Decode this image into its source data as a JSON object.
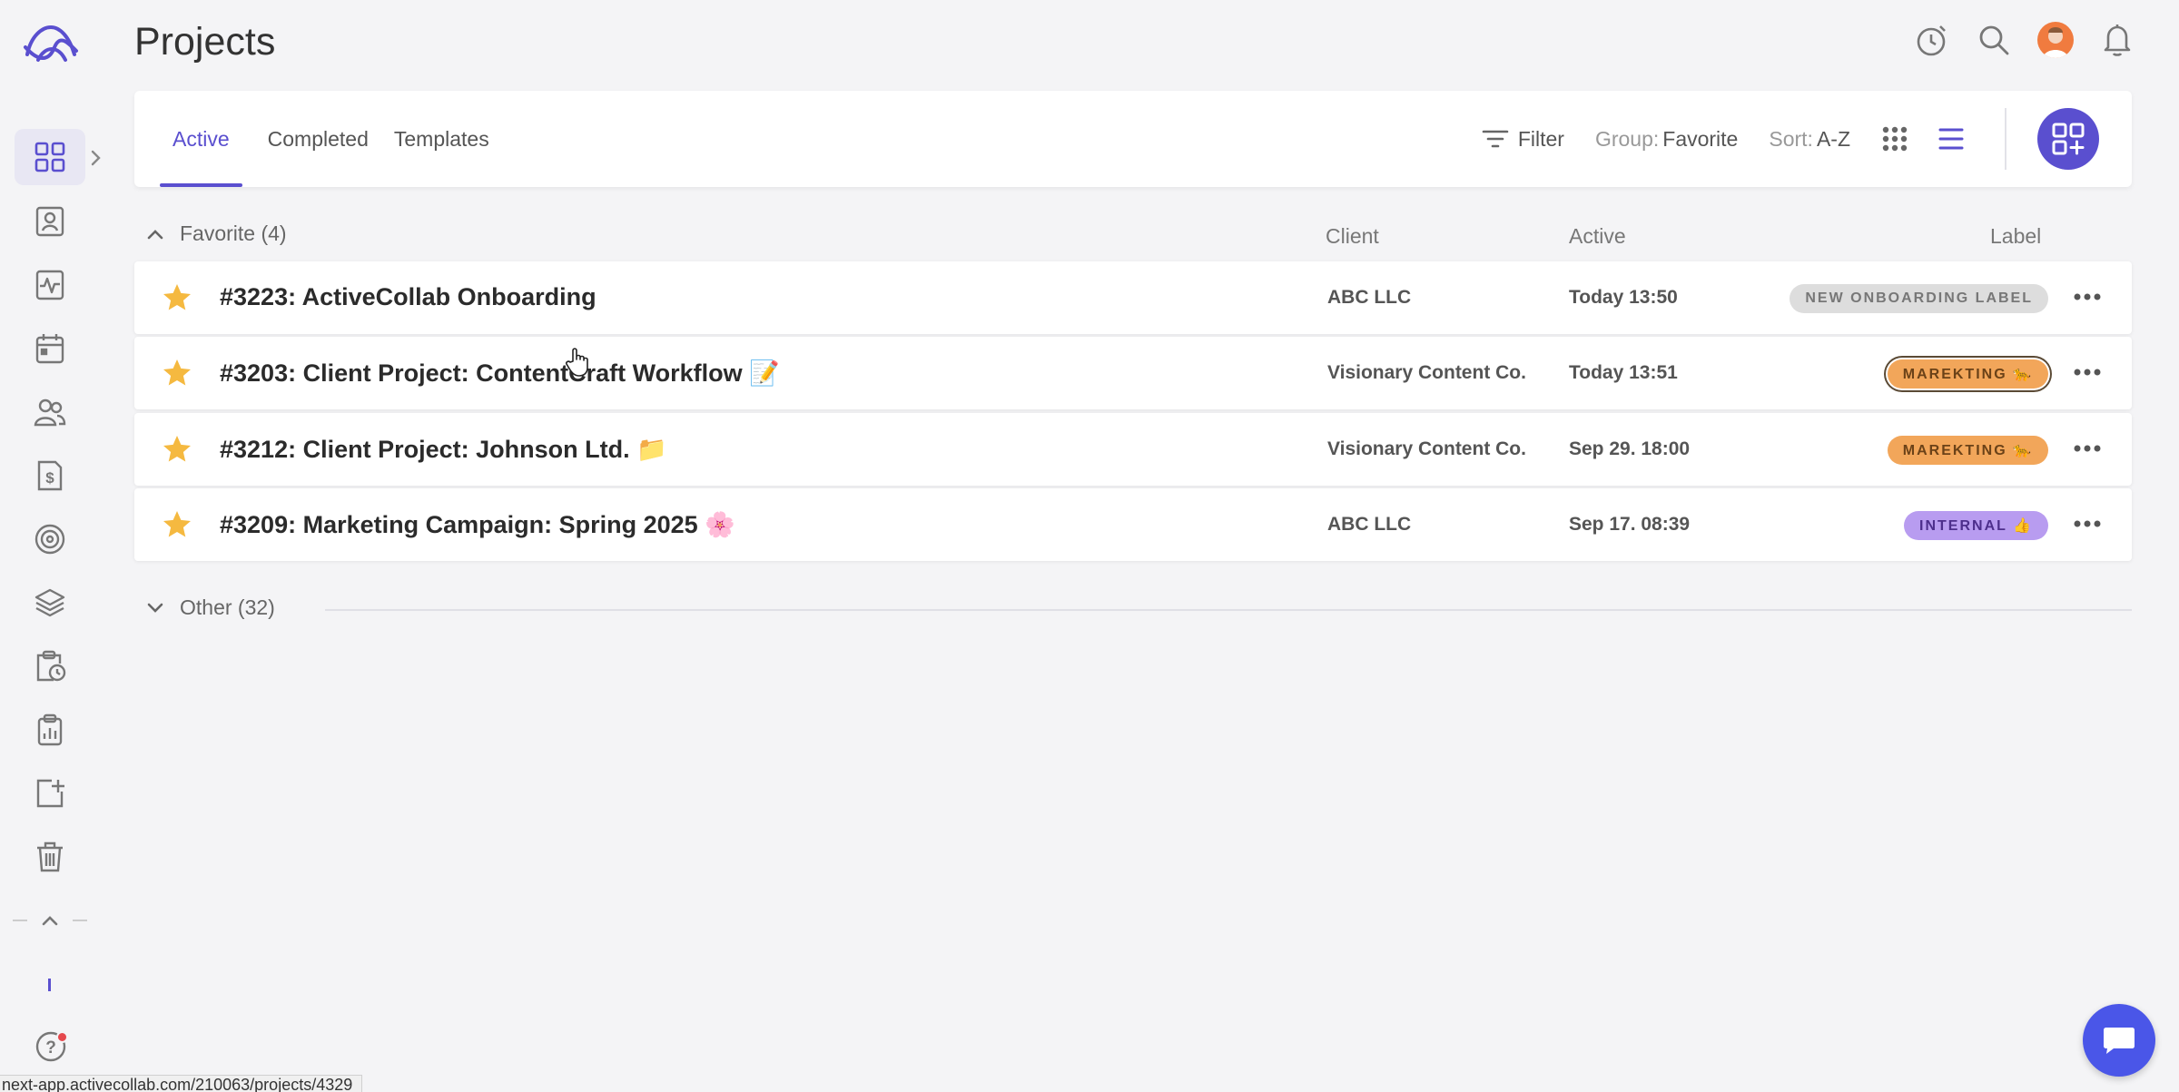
{
  "header": {
    "title": "Projects"
  },
  "tabs": [
    {
      "label": "Active",
      "active": true
    },
    {
      "label": "Completed",
      "active": false
    },
    {
      "label": "Templates",
      "active": false
    }
  ],
  "toolbar": {
    "filter_label": "Filter",
    "group_prefix": "Group:",
    "group_value": "Favorite",
    "sort_prefix": "Sort:",
    "sort_value": "A-Z"
  },
  "columns": {
    "client": "Client",
    "active": "Active",
    "label": "Label"
  },
  "groups": {
    "favorite": "Favorite (4)",
    "other": "Other (32)"
  },
  "projects": [
    {
      "name": "#3223: ActiveCollab Onboarding",
      "client": "ABC LLC",
      "active": "Today 13:50",
      "label": "NEW ONBOARDING LABEL",
      "label_color": "#dddddd"
    },
    {
      "name": "#3203: Client Project: ContentCraft Workflow 📝",
      "client": "Visionary Content Co.",
      "active": "Today 13:51",
      "label": "MAREKTING 🐆",
      "label_color": "#f2a65a"
    },
    {
      "name": "#3212: Client Project: Johnson Ltd. 📁",
      "client": "Visionary Content Co.",
      "active": "Sep 29. 18:00",
      "label": "MAREKTING 🐆",
      "label_color": "#f2a65a"
    },
    {
      "name": "#3209: Marketing Campaign: Spring 2025 🌸",
      "client": "ABC LLC",
      "active": "Sep 17. 08:39",
      "label": "INTERNAL 👍",
      "label_color": "#b89cf0"
    }
  ],
  "status_url": "next-app.activecollab.com/210063/projects/4329",
  "colors": {
    "accent": "#5a4fcf",
    "star": "#f5b940",
    "chat": "#4a56e8"
  },
  "icons": {
    "sidebar": [
      "dashboard-icon",
      "contact-card-icon",
      "activity-icon",
      "calendar-icon",
      "people-icon",
      "invoice-icon",
      "target-icon",
      "layers-icon",
      "timesheet-icon",
      "clipboard-icon",
      "add-document-icon",
      "trash-icon"
    ],
    "header": [
      "stopwatch-icon",
      "search-icon",
      "avatar",
      "bell-icon"
    ]
  }
}
